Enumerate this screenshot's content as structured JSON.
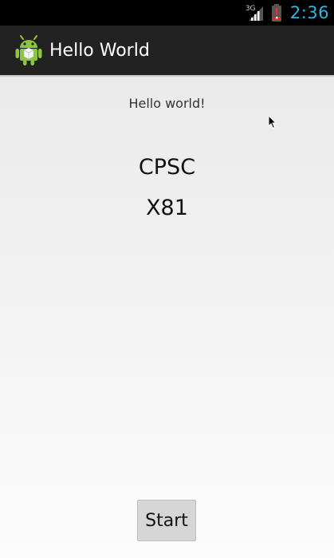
{
  "status_bar": {
    "network_type": "3G",
    "time": "2:36",
    "icons": [
      "signal-icon",
      "battery-low-icon"
    ],
    "clock_color": "#33b5e5"
  },
  "action_bar": {
    "title": "Hello World",
    "icon": "android-icon",
    "background": "#222222"
  },
  "content": {
    "hello_text": "Hello world!",
    "line1": "CPSC",
    "line2": "X81",
    "start_button": "Start"
  }
}
